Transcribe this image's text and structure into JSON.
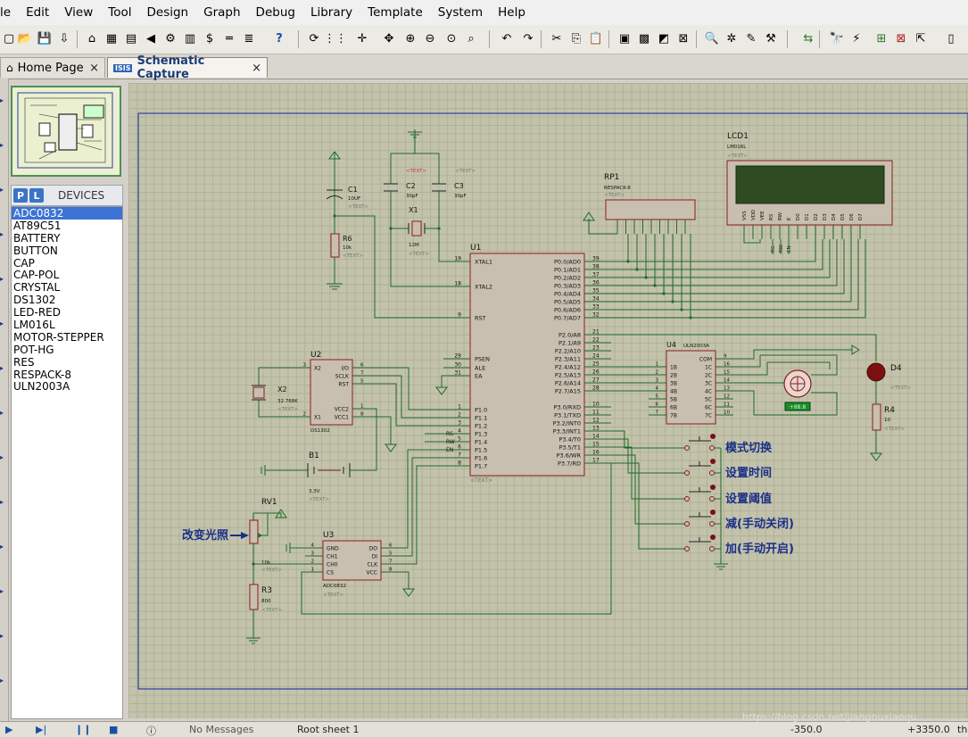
{
  "menu": [
    "le",
    "Edit",
    "View",
    "Tool",
    "Design",
    "Graph",
    "Debug",
    "Library",
    "Template",
    "System",
    "Help"
  ],
  "tabs": {
    "home": {
      "label": "Home Page",
      "close": "×"
    },
    "schematic": {
      "label": "Schematic Capture",
      "close": "×"
    }
  },
  "devices": {
    "header": "DEVICES",
    "p_btn": "P",
    "l_btn": "L",
    "items": [
      "ADC0832",
      "AT89C51",
      "BATTERY",
      "BUTTON",
      "CAP",
      "CAP-POL",
      "CRYSTAL",
      "DS1302",
      "LED-RED",
      "LM016L",
      "MOTOR-STEPPER",
      "POT-HG",
      "RES",
      "RESPACK-8",
      "ULN2003A"
    ],
    "selected": "ADC0832"
  },
  "status": {
    "messages": "No Messages",
    "sheet": "Root sheet 1",
    "x": "-350.0",
    "y": "+3350.0",
    "unit": "th",
    "watermark": "https://blog.csdn.net/jiangnuxiaoqu"
  },
  "schematic": {
    "text_placeholder": "<TEXT>",
    "components": {
      "c1": {
        "ref": "C1",
        "value": "10UF"
      },
      "r6": {
        "ref": "R6",
        "value": "10k"
      },
      "c2": {
        "ref": "C2",
        "value": "30pF"
      },
      "c3": {
        "ref": "C3",
        "value": "30pF"
      },
      "x1": {
        "ref": "X1",
        "value": "12M"
      },
      "rp1": {
        "ref": "RP1",
        "value": "RESPACK-8"
      },
      "lcd1": {
        "ref": "LCD1",
        "value": "LM016L"
      },
      "u1": {
        "ref": "U1"
      },
      "u2": {
        "ref": "U2",
        "value": "DS1302"
      },
      "x2": {
        "ref": "X2",
        "value": "32.768K"
      },
      "b1": {
        "ref": "B1",
        "value": "3.3V"
      },
      "u4": {
        "ref": "U4",
        "value": "ULN2003A"
      },
      "d4": {
        "ref": "D4"
      },
      "r4": {
        "ref": "R4",
        "value": "10"
      },
      "rv1": {
        "ref": "RV1",
        "value": "10k"
      },
      "r3": {
        "ref": "R3",
        "value": "800"
      },
      "u3": {
        "ref": "U3",
        "value": "ADC0832"
      }
    },
    "u1_left_pins": [
      {
        "name": "XTAL1",
        "num": "19"
      },
      {
        "name": "XTAL2",
        "num": "18"
      },
      {
        "name": "RST",
        "num": "9"
      },
      {
        "name": "PSEN",
        "num": "29"
      },
      {
        "name": "ALE",
        "num": "30"
      },
      {
        "name": "EA",
        "num": "31"
      },
      {
        "name": "P1.0",
        "num": "1"
      },
      {
        "name": "P1.1",
        "num": "2"
      },
      {
        "name": "P1.2",
        "num": "3"
      },
      {
        "name": "P1.3",
        "num": "4"
      },
      {
        "name": "P1.4",
        "num": "5"
      },
      {
        "name": "P1.5",
        "num": "6"
      },
      {
        "name": "P1.6",
        "num": "7"
      },
      {
        "name": "P1.7",
        "num": "8"
      }
    ],
    "u1_right_pins": [
      {
        "name": "P0.0/AD0",
        "num": "39"
      },
      {
        "name": "P0.1/AD1",
        "num": "38"
      },
      {
        "name": "P0.2/AD2",
        "num": "37"
      },
      {
        "name": "P0.3/AD3",
        "num": "36"
      },
      {
        "name": "P0.4/AD4",
        "num": "35"
      },
      {
        "name": "P0.5/AD5",
        "num": "34"
      },
      {
        "name": "P0.6/AD6",
        "num": "33"
      },
      {
        "name": "P0.7/AD7",
        "num": "32"
      },
      {
        "name": "P2.0/A8",
        "num": "21"
      },
      {
        "name": "P2.1/A9",
        "num": "22"
      },
      {
        "name": "P2.2/A10",
        "num": "23"
      },
      {
        "name": "P2.3/A11",
        "num": "24"
      },
      {
        "name": "P2.4/A12",
        "num": "25"
      },
      {
        "name": "P2.5/A13",
        "num": "26"
      },
      {
        "name": "P2.6/A14",
        "num": "27"
      },
      {
        "name": "P2.7/A15",
        "num": "28"
      },
      {
        "name": "P3.0/RXD",
        "num": "10"
      },
      {
        "name": "P3.1/TXD",
        "num": "11"
      },
      {
        "name": "P3.2/INT0",
        "num": "12"
      },
      {
        "name": "P3.3/INT1",
        "num": "13"
      },
      {
        "name": "P3.4/T0",
        "num": "14"
      },
      {
        "name": "P3.5/T1",
        "num": "15"
      },
      {
        "name": "P3.6/WR",
        "num": "16"
      },
      {
        "name": "P3.7/RD",
        "num": "17"
      }
    ],
    "u2_left": [
      {
        "name": "X2",
        "num": "3"
      },
      {
        "name": "X1",
        "num": "2"
      }
    ],
    "u2_right": [
      {
        "name": "I/O",
        "num": "6"
      },
      {
        "name": "SCLK",
        "num": "7"
      },
      {
        "name": "RST",
        "num": "5"
      },
      {
        "name": "VCC2",
        "num": "1"
      },
      {
        "name": "VCC1",
        "num": "8"
      }
    ],
    "u3_left": [
      {
        "name": "GND",
        "num": "4"
      },
      {
        "name": "CH1",
        "num": "3"
      },
      {
        "name": "CH0",
        "num": "2"
      },
      {
        "name": "CS",
        "num": "1"
      }
    ],
    "u3_right": [
      {
        "name": "DO",
        "num": "6"
      },
      {
        "name": "DI",
        "num": "5"
      },
      {
        "name": "CLK",
        "num": "7"
      },
      {
        "name": "VCC",
        "num": "8"
      }
    ],
    "u4_left": [
      {
        "name": "1B",
        "num": "1"
      },
      {
        "name": "2B",
        "num": "2"
      },
      {
        "name": "3B",
        "num": "3"
      },
      {
        "name": "4B",
        "num": "4"
      },
      {
        "name": "5B",
        "num": "5"
      },
      {
        "name": "6B",
        "num": "6"
      },
      {
        "name": "7B",
        "num": "7"
      }
    ],
    "u4_right": [
      {
        "name": "COM",
        "num": "9"
      },
      {
        "name": "1C",
        "num": "16"
      },
      {
        "name": "2C",
        "num": "15"
      },
      {
        "name": "3C",
        "num": "14"
      },
      {
        "name": "4C",
        "num": "13"
      },
      {
        "name": "5C",
        "num": "12"
      },
      {
        "name": "6C",
        "num": "11"
      },
      {
        "name": "7C",
        "num": "10"
      }
    ],
    "lcd_pins": [
      "VSS",
      "VDD",
      "VEE",
      "RS",
      "RW",
      "E",
      "D0",
      "D1",
      "D2",
      "D3",
      "D4",
      "D5",
      "D6",
      "D7"
    ],
    "rp_labels": [
      "RS",
      "RW",
      "EN"
    ],
    "p1_labels": [
      "RS",
      "RW",
      "EN"
    ],
    "motor_label": "+88.8",
    "buttons": [
      "模式切换",
      "设置时间",
      "设置阈值",
      "减(手动关闭)",
      "加(手动开启)"
    ],
    "pot_label": "改变光照"
  }
}
